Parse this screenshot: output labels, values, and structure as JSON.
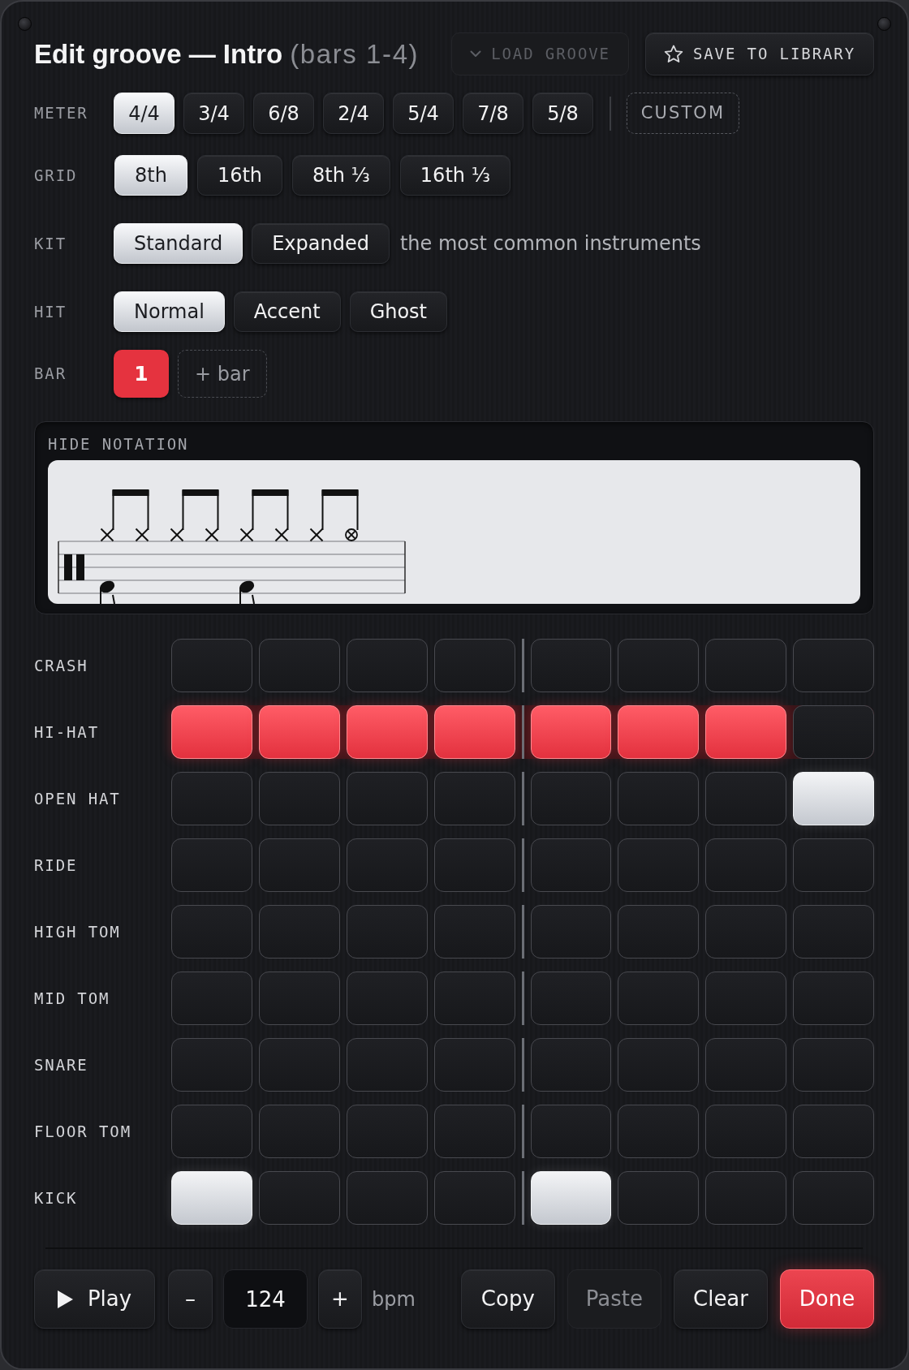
{
  "window": {
    "title": "Edit groove — Intro",
    "subtitle": "(bars 1-4)"
  },
  "header_buttons": [
    {
      "kind": "load",
      "label": "LOAD GROOVE",
      "disabled": true
    },
    {
      "kind": "save",
      "label": "SAVE TO LIBRARY",
      "disabled": false
    }
  ],
  "meter": {
    "label": "METER",
    "options": [
      {
        "label": "4/4",
        "selected": true
      },
      {
        "label": "3/4",
        "selected": false
      },
      {
        "label": "6/8",
        "selected": false
      },
      {
        "label": "2/4",
        "selected": false
      },
      {
        "label": "5/4",
        "selected": false
      },
      {
        "label": "7/8",
        "selected": false
      },
      {
        "label": "5/8",
        "selected": false
      }
    ],
    "custom": {
      "label": "CUSTOM"
    }
  },
  "grid": {
    "label": "GRID",
    "options": [
      {
        "label": "8th",
        "selected": true
      },
      {
        "label": "16th",
        "selected": false
      },
      {
        "label": "8th ⅓",
        "selected": false
      },
      {
        "label": "16th ⅓",
        "selected": false
      }
    ]
  },
  "kit": {
    "label": "KIT",
    "options": [
      {
        "label": "Standard",
        "selected": true
      },
      {
        "label": "Expanded",
        "selected": false
      }
    ],
    "hint": "the most common instruments"
  },
  "hit": {
    "label": "HIT",
    "options": [
      {
        "label": "Normal",
        "selected": true
      },
      {
        "label": "Accent",
        "selected": false
      },
      {
        "label": "Ghost",
        "selected": false
      }
    ]
  },
  "bar": {
    "label": "BAR",
    "bars": [
      {
        "label": "1",
        "selected": true
      }
    ],
    "add": {
      "label": "+ bar"
    }
  },
  "notation": {
    "toggle": "HIDE NOTATION"
  },
  "sequencer": {
    "tracks": [
      {
        "name": "CRASH",
        "kind": "crash",
        "selected": false,
        "steps": [
          false,
          false,
          false,
          false,
          false,
          false,
          false,
          false
        ]
      },
      {
        "name": "HI-HAT",
        "kind": "hihat",
        "selected": true,
        "steps": [
          true,
          true,
          true,
          true,
          true,
          true,
          true,
          false
        ]
      },
      {
        "name": "OPEN HAT",
        "kind": "openhat",
        "selected": false,
        "steps": [
          false,
          false,
          false,
          false,
          false,
          false,
          false,
          true
        ]
      },
      {
        "name": "RIDE",
        "kind": "ride",
        "selected": false,
        "steps": [
          false,
          false,
          false,
          false,
          false,
          false,
          false,
          false
        ]
      },
      {
        "name": "HIGH TOM",
        "kind": "tom_high",
        "selected": false,
        "steps": [
          false,
          false,
          false,
          false,
          false,
          false,
          false,
          false
        ]
      },
      {
        "name": "MID TOM",
        "kind": "tom_mid",
        "selected": false,
        "steps": [
          false,
          false,
          false,
          false,
          false,
          false,
          false,
          false
        ]
      },
      {
        "name": "SNARE",
        "kind": "snare",
        "selected": false,
        "steps": [
          false,
          false,
          false,
          false,
          false,
          false,
          false,
          false
        ]
      },
      {
        "name": "FLOOR TOM",
        "kind": "tom_floor",
        "selected": false,
        "steps": [
          false,
          false,
          false,
          false,
          false,
          false,
          false,
          false
        ]
      },
      {
        "name": "KICK",
        "kind": "kick",
        "selected": false,
        "steps": [
          true,
          false,
          false,
          false,
          true,
          false,
          false,
          false
        ]
      }
    ]
  },
  "transport": {
    "play": {
      "label": "Play"
    },
    "tempo": {
      "decrement": "–",
      "value": "124",
      "increment": "+",
      "unit": "bpm"
    },
    "actions": [
      {
        "label": "Copy",
        "disabled": false,
        "primary": false
      },
      {
        "label": "Paste",
        "disabled": true,
        "primary": false
      },
      {
        "label": "Clear",
        "disabled": false,
        "primary": false
      },
      {
        "label": "Done",
        "disabled": false,
        "primary": true
      }
    ]
  }
}
